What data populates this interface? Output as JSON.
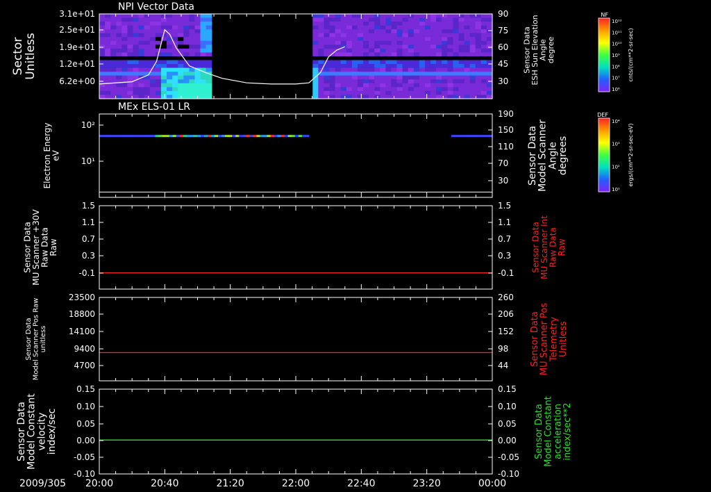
{
  "chart_data": [
    {
      "type": "heatmap",
      "title": "NPI Vector Data",
      "ylabel": "Sector Unitless",
      "ylabel_right": "Sensor Data ESH Sun Elevation Angle degree",
      "yticks": [
        "3.1e+01",
        "2.5e+01",
        "1.9e+01",
        "1.2e+01",
        "6.2e+00"
      ],
      "yticks_right": [
        "90",
        "75",
        "60",
        "45",
        "30"
      ],
      "ylim_right": [
        15,
        90
      ],
      "data_gap": [
        "21:10",
        "22:08"
      ],
      "overlay_line": {
        "x": [
          "20:00",
          "20:20",
          "20:30",
          "20:35",
          "20:40",
          "20:43",
          "20:47",
          "20:55",
          "21:05",
          "21:15",
          "21:30",
          "21:45",
          "22:00",
          "22:08",
          "22:15",
          "22:20",
          "22:25",
          "22:30"
        ],
        "y": [
          28,
          30,
          36,
          48,
          76,
          72,
          60,
          44,
          38,
          33,
          29,
          28,
          28,
          29,
          38,
          52,
          58,
          61
        ]
      },
      "colorbar": {
        "label": "NF",
        "units": "cnts/(cm**2-sr-sec)",
        "ticks": [
          "10¹²",
          "10¹¹",
          "10¹⁰",
          "10⁹",
          "10⁸",
          "10⁷",
          "10⁶"
        ]
      }
    },
    {
      "type": "heatmap",
      "title": "MEx ELS-01 LR",
      "ylabel": "Electron Energy eV",
      "ylabel_right": "Sensor Data Model Scanner Angle degrees",
      "yscale": "log",
      "yticks": [
        "10²",
        "10¹"
      ],
      "yticks_right": [
        "190",
        "150",
        "110",
        "70",
        "30"
      ],
      "ylim_right": [
        0,
        190
      ],
      "band_energy": 50,
      "band_segments": [
        [
          "20:00",
          "22:08"
        ],
        [
          "23:35",
          "24:00"
        ]
      ],
      "overlay_line": {
        "x": [
          "20:00",
          "24:00"
        ],
        "y": [
          12,
          12
        ]
      },
      "colorbar": {
        "label": "DEF",
        "units": "ergs/(cm**2-sr-sec-eV)",
        "ticks": [
          "10⁴",
          "10³",
          "10²",
          "10¹"
        ]
      }
    },
    {
      "type": "line",
      "ylabel": "Sensor Data MU Scanner +30V Raw Data Raw",
      "ylabel_right": "Sensor Data MU Scanner Int Raw Data Raw",
      "yticks": [
        "1.5",
        "1.1",
        "0.7",
        "0.3",
        "-0.1"
      ],
      "yticks_right": [
        "1.5",
        "1.1",
        "0.7",
        "0.3",
        "-0.1"
      ],
      "ylim": [
        -0.4,
        1.5
      ],
      "series": [
        {
          "color": "#ff2020",
          "x": [
            "20:00",
            "24:00"
          ],
          "y": [
            -0.03,
            -0.03
          ]
        }
      ]
    },
    {
      "type": "line",
      "ylabel": "Sensor Data Model Scanner Pos Raw unitless",
      "ylabel_right": "Sensor Data MU Scanner Pos Telemetry Unitless",
      "yticks": [
        "23500",
        "18800",
        "14100",
        "9400",
        "4700"
      ],
      "yticks_right": [
        "260",
        "206",
        "152",
        "98",
        "44"
      ],
      "ylim": [
        0,
        23500
      ],
      "series": [
        {
          "color": "#ff2020",
          "x": [
            "20:00",
            "24:00"
          ],
          "y": [
            7950,
            7950
          ]
        }
      ]
    },
    {
      "type": "line",
      "ylabel": "Sensor Data Model Constant velocity index/sec",
      "ylabel_right": "Sensor Data Model Constant acceleration index/sec**2",
      "yticks": [
        "0.15",
        "0.10",
        "0.05",
        "0.00",
        "-0.05",
        "-0.10"
      ],
      "yticks_right": [
        "0.15",
        "0.10",
        "0.05",
        "0.00",
        "-0.05",
        "-0.10"
      ],
      "ylim": [
        -0.1,
        0.15
      ],
      "series": [
        {
          "color": "#30dd30",
          "x": [
            "20:00",
            "24:00"
          ],
          "y": [
            0.0,
            0.0
          ]
        }
      ]
    }
  ],
  "xaxis": {
    "date": "2009/305",
    "ticks": [
      "20:00",
      "20:40",
      "21:20",
      "22:00",
      "22:40",
      "23:20",
      "00:00"
    ]
  },
  "colors": {
    "left_label": "#ffffff",
    "right_red": "#ff2020",
    "right_green": "#30dd30"
  }
}
